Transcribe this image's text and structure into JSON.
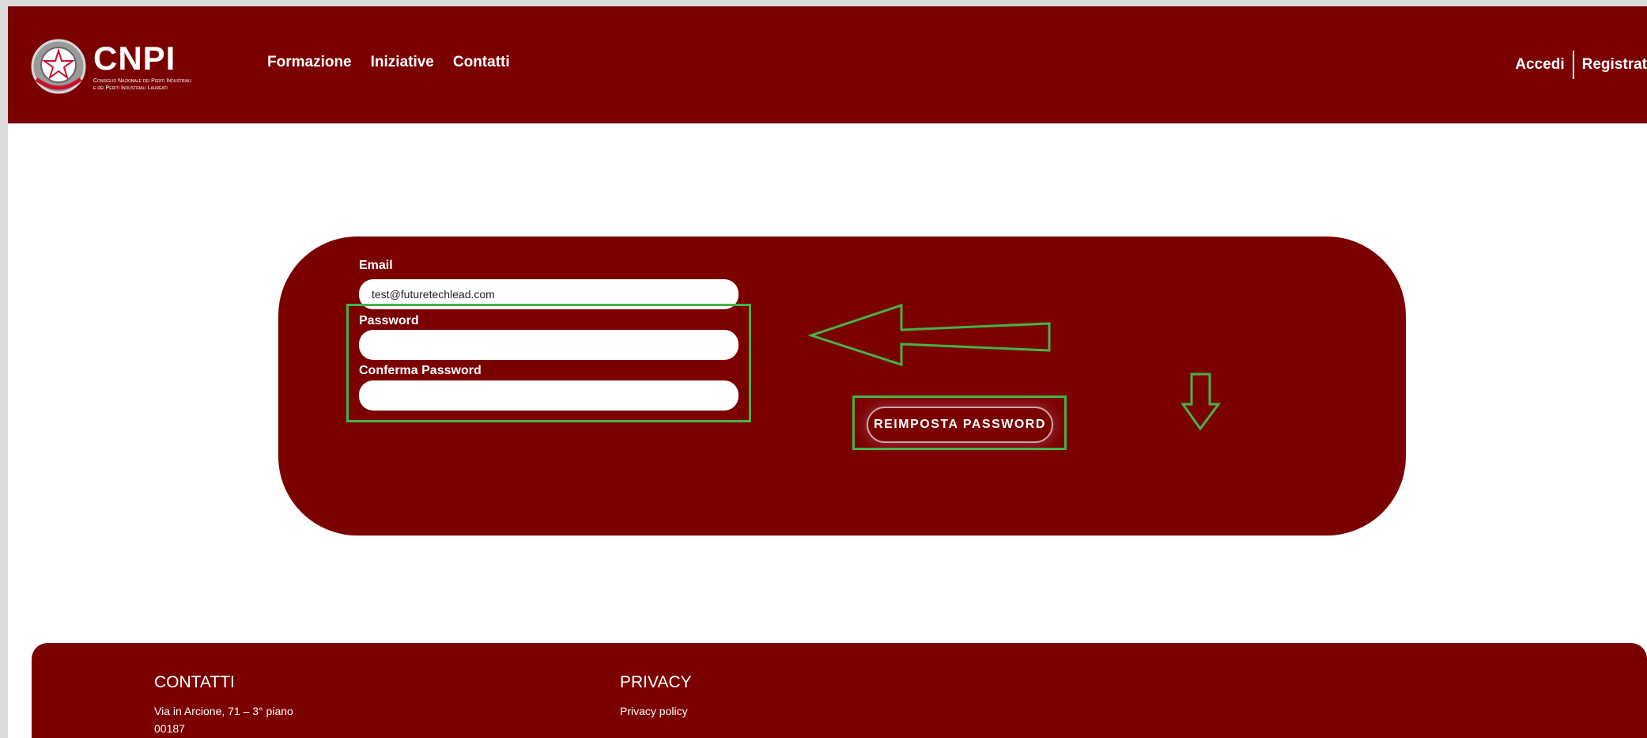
{
  "header": {
    "logo_text": "CNPI",
    "logo_subtitle_1": "Consiglio Nazionale dei Periti Industriali",
    "logo_subtitle_2": "e dei Periti Industriali Laureati",
    "nav": [
      "Formazione",
      "Iniziative",
      "Contatti"
    ],
    "login": "Accedi",
    "register": "Registrat"
  },
  "form": {
    "email_label": "Email",
    "email_value": "test@futuretechlead.com",
    "password_label": "Password",
    "password_value": "",
    "confirm_label": "Conferma Password",
    "confirm_value": "",
    "submit_label": "REIMPOSTA PASSWORD"
  },
  "footer": {
    "contacts_title": "CONTATTI",
    "address_line1": "Via in Arcione, 71 – 3° piano",
    "address_line2": "00187",
    "privacy_title": "PRIVACY",
    "privacy_link": "Privacy policy"
  },
  "colors": {
    "brand": "#7b0000",
    "annotation": "#47b247",
    "accent_red": "#e0282e"
  },
  "icons": {
    "emblem": "italian-republic-emblem-icon",
    "arrow_left": "arrow-left-outline-icon",
    "arrow_down": "arrow-down-outline-icon"
  }
}
